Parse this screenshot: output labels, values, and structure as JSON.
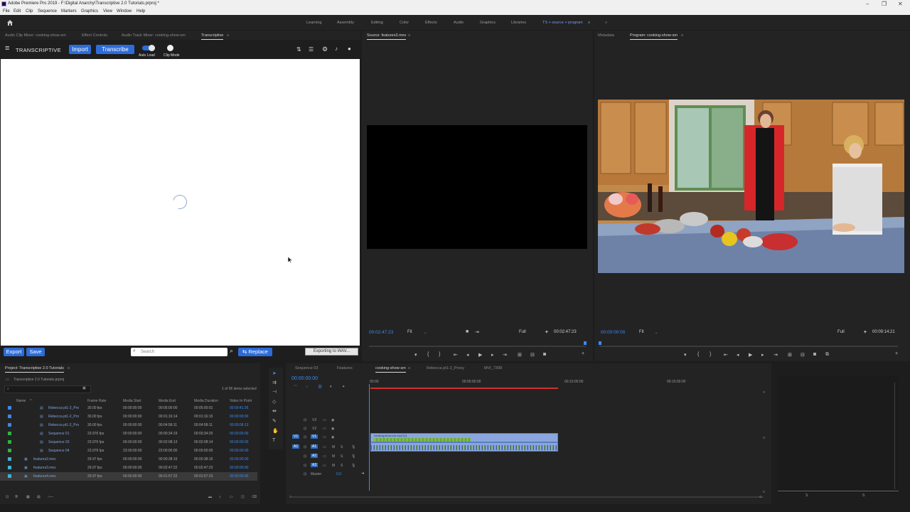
{
  "window": {
    "title": "Adobe Premiere Pro 2019 - F:\\Digital Anarchy\\Transcriptive 2.0 Tutorials.prproj *",
    "controls": [
      "–",
      "❐",
      "✕"
    ]
  },
  "menu": [
    "File",
    "Edit",
    "Clip",
    "Sequence",
    "Markers",
    "Graphics",
    "View",
    "Window",
    "Help"
  ],
  "workspaces": [
    "Learning",
    "Assembly",
    "Editing",
    "Color",
    "Effects",
    "Audio",
    "Graphics",
    "Libraries",
    "TS + source + program"
  ],
  "workspace_overflow": "»",
  "left_tabs": [
    "Audio Clip Mixer: cooking-show-sm",
    "Effect Controls",
    "Audio Track Mixer: cooking-show-sm",
    "Transcriptive"
  ],
  "transcriptive": {
    "logo": "TRANSCRIPTIVE",
    "import_label": "Import",
    "transcribe_label": "Transcribe",
    "auto_load_label": "Auto Load",
    "clip_mode_label": "Clip Mode",
    "export_label": "Export",
    "save_label": "Save",
    "search_placeholder": "Search",
    "replace_label": "Replace",
    "status_label": "Exporting to WAV..."
  },
  "source": {
    "tab": "Source: features3.mov",
    "timecode_left": "00:02:47:23",
    "fit": "Fit",
    "quality": "Full",
    "timecode_right": "00:02:47:23"
  },
  "program": {
    "tabs": [
      "Metadata",
      "Program: cooking-show-sm"
    ],
    "timecode_left": "00:00:00:00",
    "fit": "Fit",
    "quality": "Full",
    "timecode_right": "00:09:14:21"
  },
  "project": {
    "title": "Project: Transcriptive 2.0 Tutorials",
    "file": "Transcriptive 2.0 Tutorials.prproj",
    "selection": "1 of 96 items selected",
    "columns": [
      "Name",
      "Frame Rate",
      "Media Start",
      "Media End",
      "Media Duration",
      "Video In Point"
    ],
    "rows": [
      {
        "name": "Rebecca pt1-2_Pro",
        "rate": "30.00 fps",
        "start": "00:00:00:00",
        "end": "00:05:00:00",
        "dur": "00:05:00:01",
        "vin": "00:00:41:26",
        "color": "#3f86e8"
      },
      {
        "name": "Rebecca pt1-2_Pro",
        "rate": "30.00 fps",
        "start": "00:00:00:00",
        "end": "00:01:16:14",
        "dur": "00:01:16:15",
        "vin": "00:00:00:00",
        "color": "#3f86e8"
      },
      {
        "name": "Rebecca pt1-2_Pro",
        "rate": "30.00 fps",
        "start": "00:00:00:00",
        "end": "00:04:58:11",
        "dur": "00:04:58:11",
        "vin": "00:00:08:13",
        "color": "#3f86e8"
      },
      {
        "name": "Sequence 01",
        "rate": "23.976 fps",
        "start": "00:00:00:00",
        "end": "00:00:34:19",
        "dur": "00:00:34:20",
        "vin": "00:00:00:00",
        "color": "#2fb341"
      },
      {
        "name": "Sequence 03",
        "rate": "23.976 fps",
        "start": "00:00:00:00",
        "end": "00:02:08:13",
        "dur": "00:02:08:14",
        "vin": "00:00:00:00",
        "color": "#2fb341"
      },
      {
        "name": "Sequence 04",
        "rate": "23.976 fps",
        "start": "23:00:00:00",
        "end": "23:00:00:00",
        "dur": "00:00:00:00",
        "vin": "00:00:00:00",
        "color": "#2fb341"
      },
      {
        "name": "features2.mov",
        "rate": "29.97 fps",
        "start": "00:00:00:00",
        "end": "00:00:38:15",
        "dur": "00:00:38:16",
        "vin": "00:00:00:00",
        "color": "#3fb0d9"
      },
      {
        "name": "features3.mov",
        "rate": "29.97 fps",
        "start": "00:00:00:00",
        "end": "00:02:47:22",
        "dur": "00:02:47:23",
        "vin": "00:00:00:00",
        "color": "#3fb0d9"
      },
      {
        "name": "features4.mov",
        "rate": "29.97 fps",
        "start": "00:00:00:00",
        "end": "00:01:57:22",
        "dur": "00:01:57:23",
        "vin": "00:00:00:00",
        "color": "#3fb0d9"
      }
    ]
  },
  "timeline": {
    "tabs": [
      "Sequence 03",
      "Features",
      "cooking-show-sm",
      "Rebecca pt1-2_Proxy",
      "MVI_7308"
    ],
    "timecode": "00:00:00:00",
    "ruler": [
      "00:00",
      "00:05:00:00",
      "00:10:00:00",
      "00:15:00:00"
    ],
    "tracks": [
      "V3",
      "V2",
      "V1",
      "A1",
      "A2",
      "A3"
    ],
    "master_label": "Master",
    "master_value": "0.0",
    "clip_label": "cooking-show-sm.mp4 [V]"
  },
  "meter_labels": [
    "S",
    "S"
  ]
}
